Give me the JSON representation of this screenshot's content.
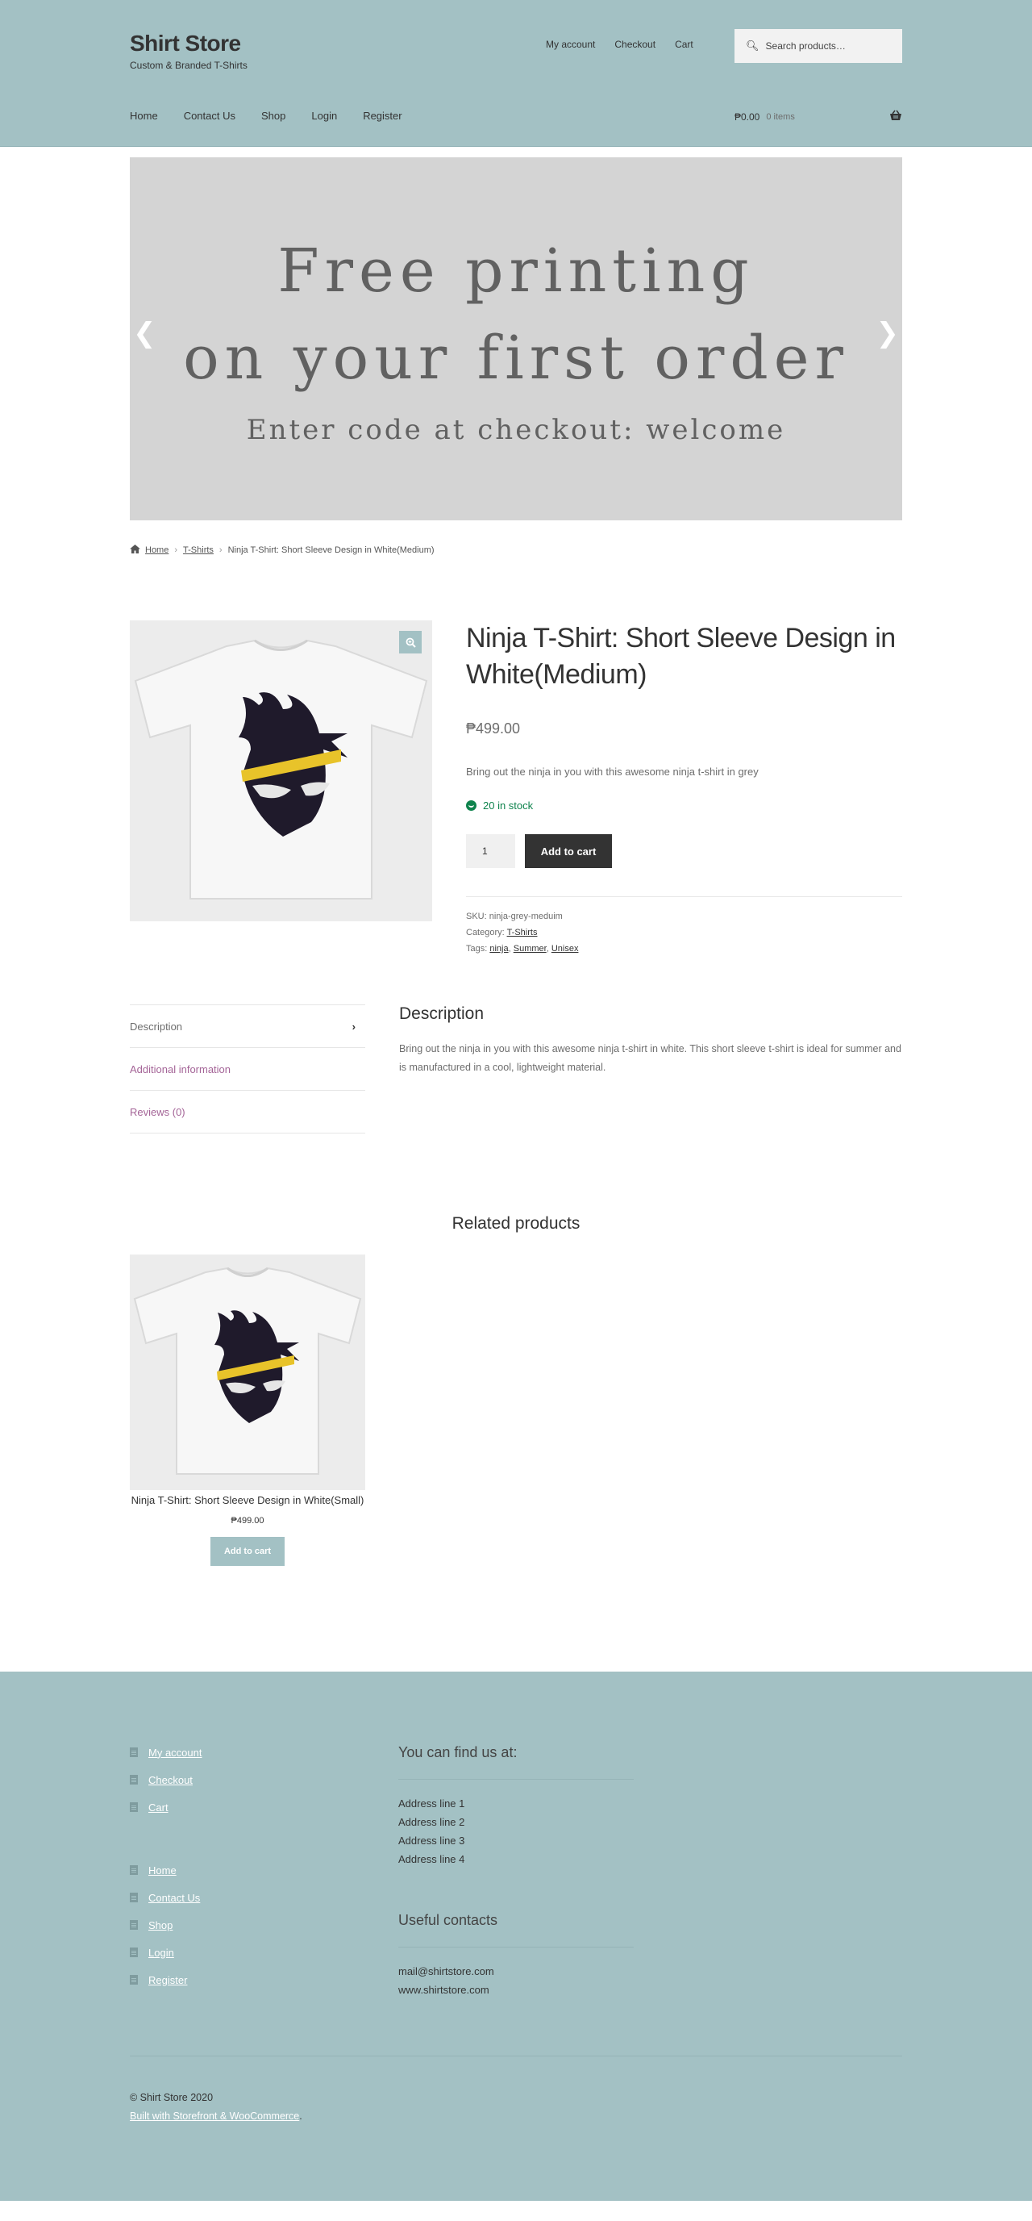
{
  "header": {
    "site_title": "Shirt Store",
    "tagline": "Custom & Branded T-Shirts",
    "secondary_nav": [
      "My account",
      "Checkout",
      "Cart"
    ],
    "search_placeholder": "Search products…",
    "primary_nav": [
      "Home",
      "Contact Us",
      "Shop",
      "Login",
      "Register"
    ],
    "cart_amount": "₱0.00",
    "cart_count": "0 items",
    "accent_color": "#a3c1c4"
  },
  "hero": {
    "line1": "Free printing",
    "line2": "on your first order",
    "subline": "Enter code at checkout: welcome",
    "prev_icon": "chevron-left-icon",
    "next_icon": "chevron-right-icon"
  },
  "breadcrumb": {
    "home": "Home",
    "category": "T-Shirts",
    "current": "Ninja T-Shirt: Short Sleeve Design in White(Medium)"
  },
  "product": {
    "title": "Ninja T-Shirt: Short Sleeve Design in White(Medium)",
    "price": "₱499.00",
    "short_description": "Bring out the ninja in you with this awesome ninja t-shirt in grey",
    "stock": "20 in stock",
    "quantity": "1",
    "add_to_cart": "Add to cart",
    "sku_label": "SKU:",
    "sku": "ninja-grey-meduim",
    "category_label": "Category:",
    "category": "T-Shirts",
    "tags_label": "Tags:",
    "tags": [
      "ninja",
      "Summer",
      "Unisex"
    ],
    "stock_color": "#0f834d"
  },
  "tabs": {
    "items": [
      "Description",
      "Additional information",
      "Reviews (0)"
    ],
    "panel_title": "Description",
    "panel_text": "Bring out the ninja in you with this awesome ninja t-shirt in white. This short sleeve t-shirt is ideal for summer and is manufactured in a cool, lightweight material."
  },
  "related": {
    "heading": "Related products",
    "products": [
      {
        "title": "Ninja T-Shirt: Short Sleeve Design in White(Small)",
        "price": "₱499.00",
        "button": "Add to cart"
      }
    ]
  },
  "footer": {
    "menu1": [
      "My account",
      "Checkout",
      "Cart"
    ],
    "menu2": [
      "Home",
      "Contact Us",
      "Shop",
      "Login",
      "Register"
    ],
    "find_us_heading": "You can find us at:",
    "address_lines": [
      "Address line 1",
      "Address line 2",
      "Address line 3",
      "Address line 4"
    ],
    "contacts_heading": "Useful contacts",
    "contacts": [
      "mail@shirtstore.com",
      "www.shirtstore.com"
    ],
    "copyright": "© Shirt Store 2020",
    "credit": "Built with Storefront & WooCommerce",
    "credit_suffix": "."
  }
}
